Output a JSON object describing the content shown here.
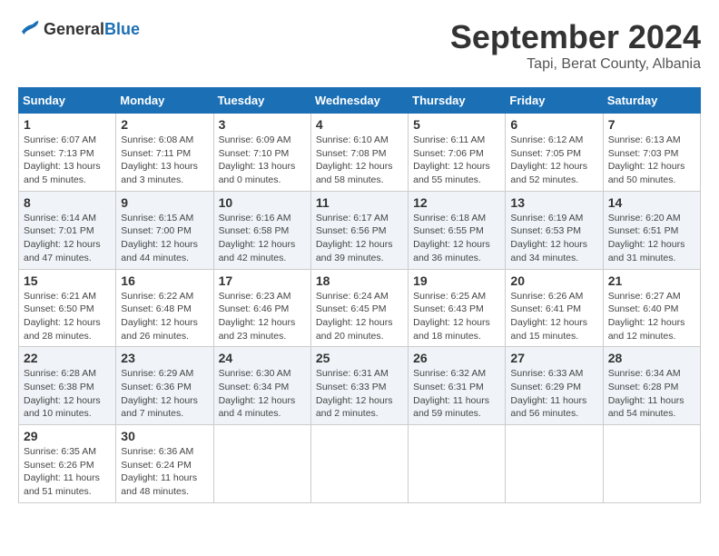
{
  "header": {
    "logo_general": "General",
    "logo_blue": "Blue",
    "month": "September 2024",
    "location": "Tapi, Berat County, Albania"
  },
  "weekdays": [
    "Sunday",
    "Monday",
    "Tuesday",
    "Wednesday",
    "Thursday",
    "Friday",
    "Saturday"
  ],
  "weeks": [
    [
      {
        "day": "1",
        "sunrise": "6:07 AM",
        "sunset": "7:13 PM",
        "daylight": "13 hours and 5 minutes."
      },
      {
        "day": "2",
        "sunrise": "6:08 AM",
        "sunset": "7:11 PM",
        "daylight": "13 hours and 3 minutes."
      },
      {
        "day": "3",
        "sunrise": "6:09 AM",
        "sunset": "7:10 PM",
        "daylight": "13 hours and 0 minutes."
      },
      {
        "day": "4",
        "sunrise": "6:10 AM",
        "sunset": "7:08 PM",
        "daylight": "12 hours and 58 minutes."
      },
      {
        "day": "5",
        "sunrise": "6:11 AM",
        "sunset": "7:06 PM",
        "daylight": "12 hours and 55 minutes."
      },
      {
        "day": "6",
        "sunrise": "6:12 AM",
        "sunset": "7:05 PM",
        "daylight": "12 hours and 52 minutes."
      },
      {
        "day": "7",
        "sunrise": "6:13 AM",
        "sunset": "7:03 PM",
        "daylight": "12 hours and 50 minutes."
      }
    ],
    [
      {
        "day": "8",
        "sunrise": "6:14 AM",
        "sunset": "7:01 PM",
        "daylight": "12 hours and 47 minutes."
      },
      {
        "day": "9",
        "sunrise": "6:15 AM",
        "sunset": "7:00 PM",
        "daylight": "12 hours and 44 minutes."
      },
      {
        "day": "10",
        "sunrise": "6:16 AM",
        "sunset": "6:58 PM",
        "daylight": "12 hours and 42 minutes."
      },
      {
        "day": "11",
        "sunrise": "6:17 AM",
        "sunset": "6:56 PM",
        "daylight": "12 hours and 39 minutes."
      },
      {
        "day": "12",
        "sunrise": "6:18 AM",
        "sunset": "6:55 PM",
        "daylight": "12 hours and 36 minutes."
      },
      {
        "day": "13",
        "sunrise": "6:19 AM",
        "sunset": "6:53 PM",
        "daylight": "12 hours and 34 minutes."
      },
      {
        "day": "14",
        "sunrise": "6:20 AM",
        "sunset": "6:51 PM",
        "daylight": "12 hours and 31 minutes."
      }
    ],
    [
      {
        "day": "15",
        "sunrise": "6:21 AM",
        "sunset": "6:50 PM",
        "daylight": "12 hours and 28 minutes."
      },
      {
        "day": "16",
        "sunrise": "6:22 AM",
        "sunset": "6:48 PM",
        "daylight": "12 hours and 26 minutes."
      },
      {
        "day": "17",
        "sunrise": "6:23 AM",
        "sunset": "6:46 PM",
        "daylight": "12 hours and 23 minutes."
      },
      {
        "day": "18",
        "sunrise": "6:24 AM",
        "sunset": "6:45 PM",
        "daylight": "12 hours and 20 minutes."
      },
      {
        "day": "19",
        "sunrise": "6:25 AM",
        "sunset": "6:43 PM",
        "daylight": "12 hours and 18 minutes."
      },
      {
        "day": "20",
        "sunrise": "6:26 AM",
        "sunset": "6:41 PM",
        "daylight": "12 hours and 15 minutes."
      },
      {
        "day": "21",
        "sunrise": "6:27 AM",
        "sunset": "6:40 PM",
        "daylight": "12 hours and 12 minutes."
      }
    ],
    [
      {
        "day": "22",
        "sunrise": "6:28 AM",
        "sunset": "6:38 PM",
        "daylight": "12 hours and 10 minutes."
      },
      {
        "day": "23",
        "sunrise": "6:29 AM",
        "sunset": "6:36 PM",
        "daylight": "12 hours and 7 minutes."
      },
      {
        "day": "24",
        "sunrise": "6:30 AM",
        "sunset": "6:34 PM",
        "daylight": "12 hours and 4 minutes."
      },
      {
        "day": "25",
        "sunrise": "6:31 AM",
        "sunset": "6:33 PM",
        "daylight": "12 hours and 2 minutes."
      },
      {
        "day": "26",
        "sunrise": "6:32 AM",
        "sunset": "6:31 PM",
        "daylight": "11 hours and 59 minutes."
      },
      {
        "day": "27",
        "sunrise": "6:33 AM",
        "sunset": "6:29 PM",
        "daylight": "11 hours and 56 minutes."
      },
      {
        "day": "28",
        "sunrise": "6:34 AM",
        "sunset": "6:28 PM",
        "daylight": "11 hours and 54 minutes."
      }
    ],
    [
      {
        "day": "29",
        "sunrise": "6:35 AM",
        "sunset": "6:26 PM",
        "daylight": "11 hours and 51 minutes."
      },
      {
        "day": "30",
        "sunrise": "6:36 AM",
        "sunset": "6:24 PM",
        "daylight": "11 hours and 48 minutes."
      },
      null,
      null,
      null,
      null,
      null
    ]
  ]
}
